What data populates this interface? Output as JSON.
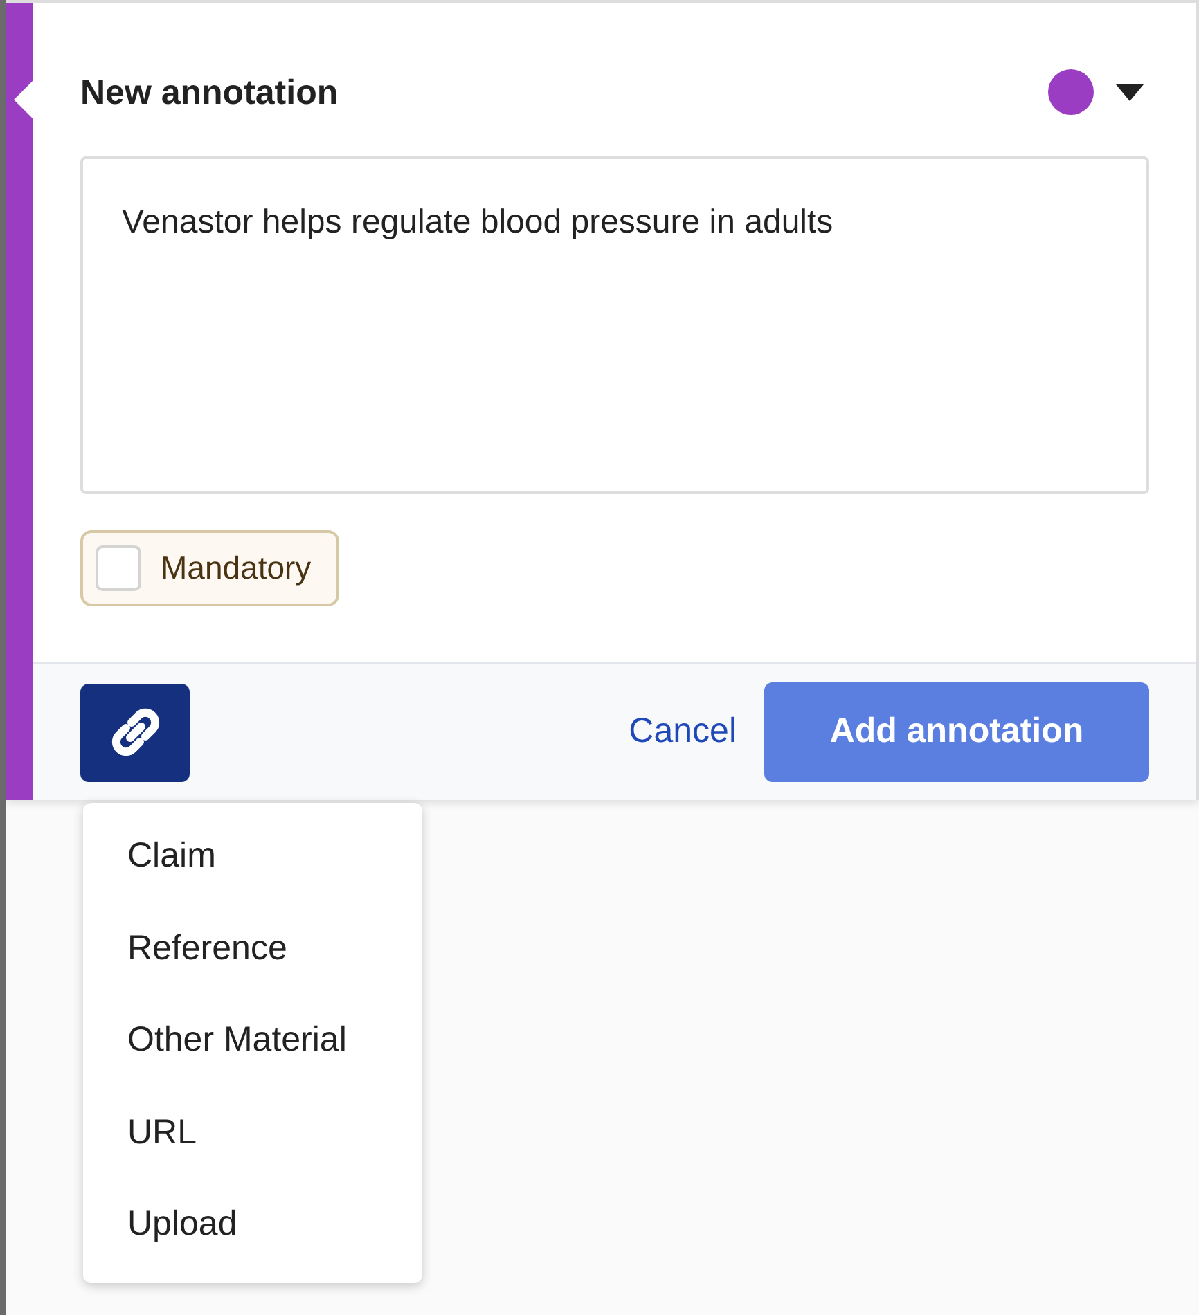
{
  "annotation": {
    "title": "New annotation",
    "color": "#9b3dc3",
    "text": "Venastor helps regulate blood pressure in adults",
    "mandatory": {
      "label": "Mandatory",
      "checked": false
    },
    "link_button": {
      "expanded": true
    },
    "cancel": "Cancel",
    "submit": "Add annotation"
  },
  "link_menu": [
    {
      "label": "Claim"
    },
    {
      "label": "Reference"
    },
    {
      "label": "Other Material"
    },
    {
      "label": "URL"
    },
    {
      "label": "Upload"
    }
  ]
}
